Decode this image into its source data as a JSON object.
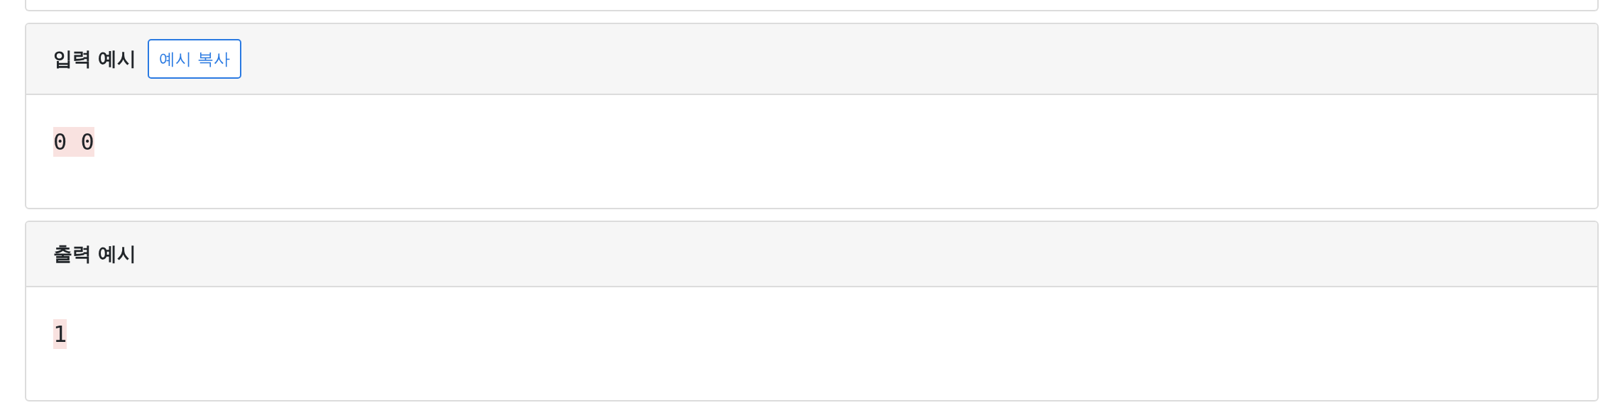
{
  "samples": [
    {
      "title": "입력 예시",
      "copy_button": "예시 복사",
      "content": "0 0"
    },
    {
      "title": "출력 예시",
      "content": "1"
    }
  ]
}
